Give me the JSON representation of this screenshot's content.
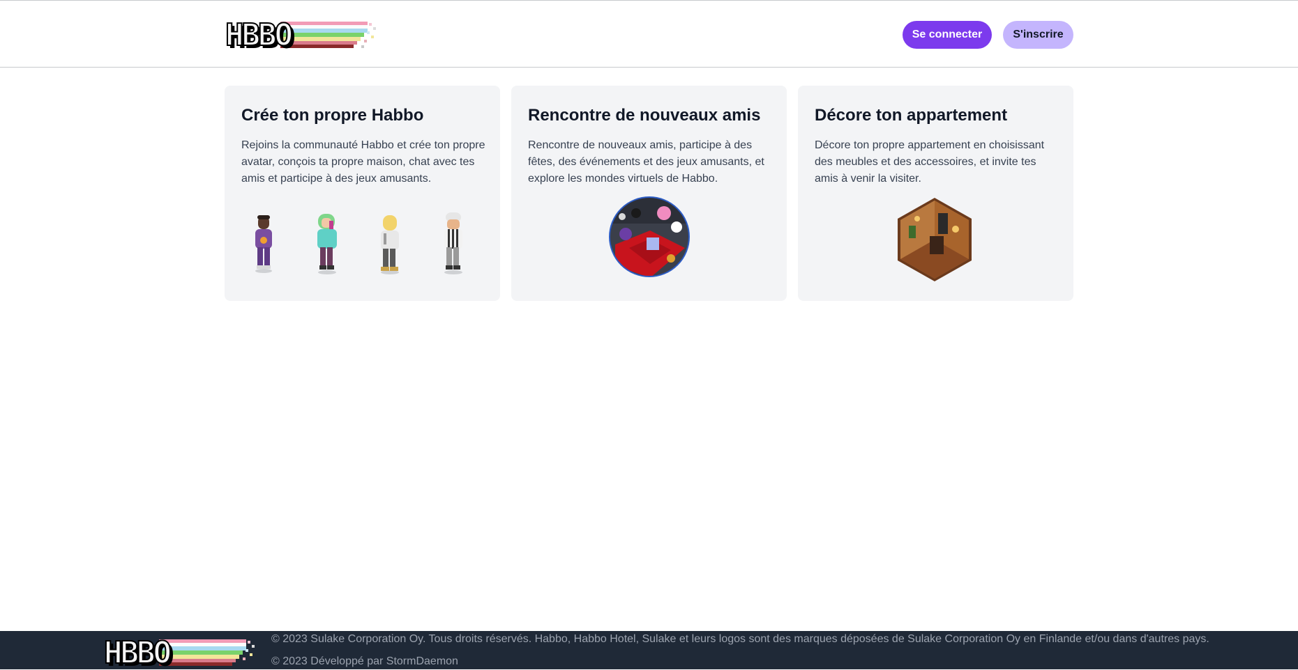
{
  "header": {
    "logo_text": "HABBO",
    "login_label": "Se connecter",
    "register_label": "S'inscrire"
  },
  "cards": [
    {
      "title": "Crée ton propre Habbo",
      "text": "Rejoins la communauté Habbo et crée ton propre avatar, conçois ta propre maison, chat avec tes amis et participe à des jeux amusants."
    },
    {
      "title": "Rencontre de nouveaux amis",
      "text": "Rencontre de nouveaux amis, participe à des fêtes, des événements et des jeux amusants, et explore les mondes virtuels de Habbo."
    },
    {
      "title": "Décore ton appartement",
      "text": "Décore ton propre appartement en choisissant des meubles et des accessoires, et invite tes amis à venir la visiter."
    }
  ],
  "footer": {
    "logo_text": "HABBO",
    "copyright": "© 2023 Sulake Corporation Oy. Tous droits réservés. Habbo, Habbo Hotel, Sulake et leurs logos sont des marques déposées de Sulake Corporation Oy en Finlande et/ou dans d'autres pays.",
    "developer": "© 2023 Développé par StormDaemon"
  },
  "colors": {
    "primary": "#7c3aed",
    "primary_light": "#c4b5fd",
    "card_bg": "#f3f4f6",
    "footer_bg": "#1f2937"
  }
}
